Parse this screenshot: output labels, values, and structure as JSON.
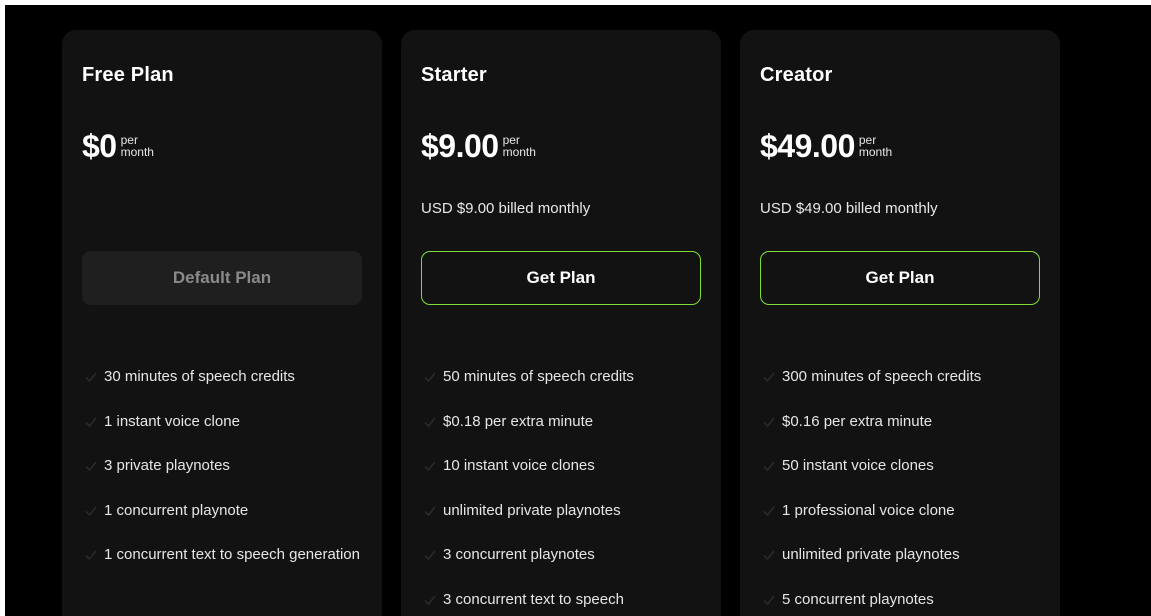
{
  "colors": {
    "background": "#000000",
    "card": "#121212",
    "accent_border": "#7fdc3a",
    "disabled_button": "#1f1f1f",
    "disabled_text": "#8a8a8a"
  },
  "plans": [
    {
      "name": "Free Plan",
      "price": "$0",
      "per_top": "per",
      "per_bottom": "month",
      "billing": "",
      "button": "Default Plan",
      "features": [
        "30 minutes of speech credits",
        "1 instant voice clone",
        "3 private playnotes",
        "1 concurrent playnote",
        "1 concurrent text to speech generation"
      ]
    },
    {
      "name": "Starter",
      "price": "$9.00",
      "per_top": "per",
      "per_bottom": "month",
      "billing": "USD $9.00 billed monthly",
      "button": "Get Plan",
      "features": [
        "50 minutes of speech credits",
        "$0.18 per extra minute",
        "10 instant voice clones",
        "unlimited private playnotes",
        "3 concurrent playnotes",
        "3 concurrent text to speech"
      ]
    },
    {
      "name": "Creator",
      "price": "$49.00",
      "per_top": "per",
      "per_bottom": "month",
      "billing": "USD $49.00 billed monthly",
      "button": "Get Plan",
      "features": [
        "300 minutes of speech credits",
        "$0.16 per extra minute",
        "50 instant voice clones",
        "1 professional voice clone",
        "unlimited private playnotes",
        "5 concurrent playnotes"
      ]
    }
  ]
}
